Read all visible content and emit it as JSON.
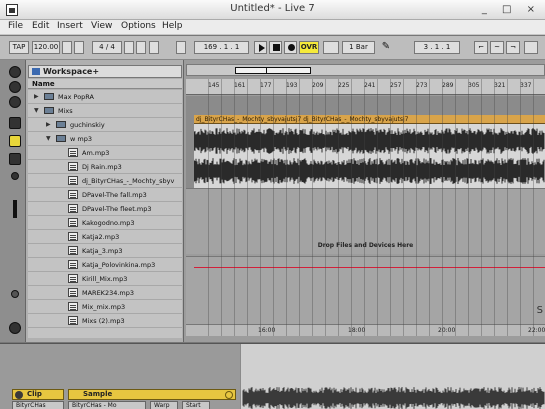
{
  "window": {
    "title": "Untitled* - Live 7",
    "controls": "_ □ ×"
  },
  "menu": [
    "File",
    "Edit",
    "Insert",
    "View",
    "Options",
    "Help"
  ],
  "control_bar": {
    "tap": "TAP",
    "tempo": "120.00",
    "time_signature": "4 / 4",
    "position": "169 . 1 . 1",
    "ovr": "OVR",
    "quantize": "1 Bar",
    "loop_start": "3 . 1 . 1",
    "pencil_icon": "pencil-icon"
  },
  "browser": {
    "title": "Workspace+",
    "column_header": "Name",
    "rows": [
      {
        "type": "folder",
        "expanded": false,
        "indent": 0,
        "label": "Max PopRA"
      },
      {
        "type": "folder",
        "expanded": true,
        "indent": 0,
        "label": "Mixs"
      },
      {
        "type": "folder",
        "expanded": false,
        "indent": 1,
        "label": "guchinskiy"
      },
      {
        "type": "folder",
        "expanded": true,
        "indent": 1,
        "label": "w mp3"
      },
      {
        "type": "file",
        "indent": 2,
        "label": "Am.mp3"
      },
      {
        "type": "file",
        "indent": 2,
        "label": "Dj Rain.mp3"
      },
      {
        "type": "file",
        "indent": 2,
        "label": "dj_BityrCHas_-_Mochty_sbyv"
      },
      {
        "type": "file",
        "indent": 2,
        "label": "DPavel-The fall.mp3"
      },
      {
        "type": "file",
        "indent": 2,
        "label": "DPavel-The fleet.mp3"
      },
      {
        "type": "file",
        "indent": 2,
        "label": "Kakogodno.mp3"
      },
      {
        "type": "file",
        "indent": 2,
        "label": "Katja2.mp3"
      },
      {
        "type": "file",
        "indent": 2,
        "label": "Katja_3.mp3"
      },
      {
        "type": "file",
        "indent": 2,
        "label": "Katja_Polovinkina.mp3"
      },
      {
        "type": "file",
        "indent": 2,
        "label": "Kirill_Mix.mp3"
      },
      {
        "type": "file",
        "indent": 2,
        "label": "MAREK234.mp3"
      },
      {
        "type": "file",
        "indent": 2,
        "label": "Mix_mix.mp3"
      },
      {
        "type": "file",
        "indent": 2,
        "label": "Mixs (2).mp3"
      }
    ]
  },
  "arrangement": {
    "ruler": [
      "145",
      "161",
      "177",
      "193",
      "209",
      "225",
      "241",
      "257",
      "273",
      "289",
      "305",
      "321",
      "337"
    ],
    "clip_name": "dj_BityrCHas_-_Mochty_sbyvajutsj7  dj_BityrCHas_-_Mochty_sbyvajutsj7",
    "drop_text": "Drop Files and Devices Here",
    "time_marks": [
      "16:00",
      "18:00",
      "20:00",
      "22:00"
    ],
    "side_marker": "S"
  },
  "detail": {
    "clip_label": "Clip",
    "sample_label": "Sample",
    "clip_sub": "BityrCHas",
    "sample_sub": "BityrCHas - Mo",
    "warp": "Warp",
    "start": "Start",
    "accent_color": "#e7c640"
  }
}
